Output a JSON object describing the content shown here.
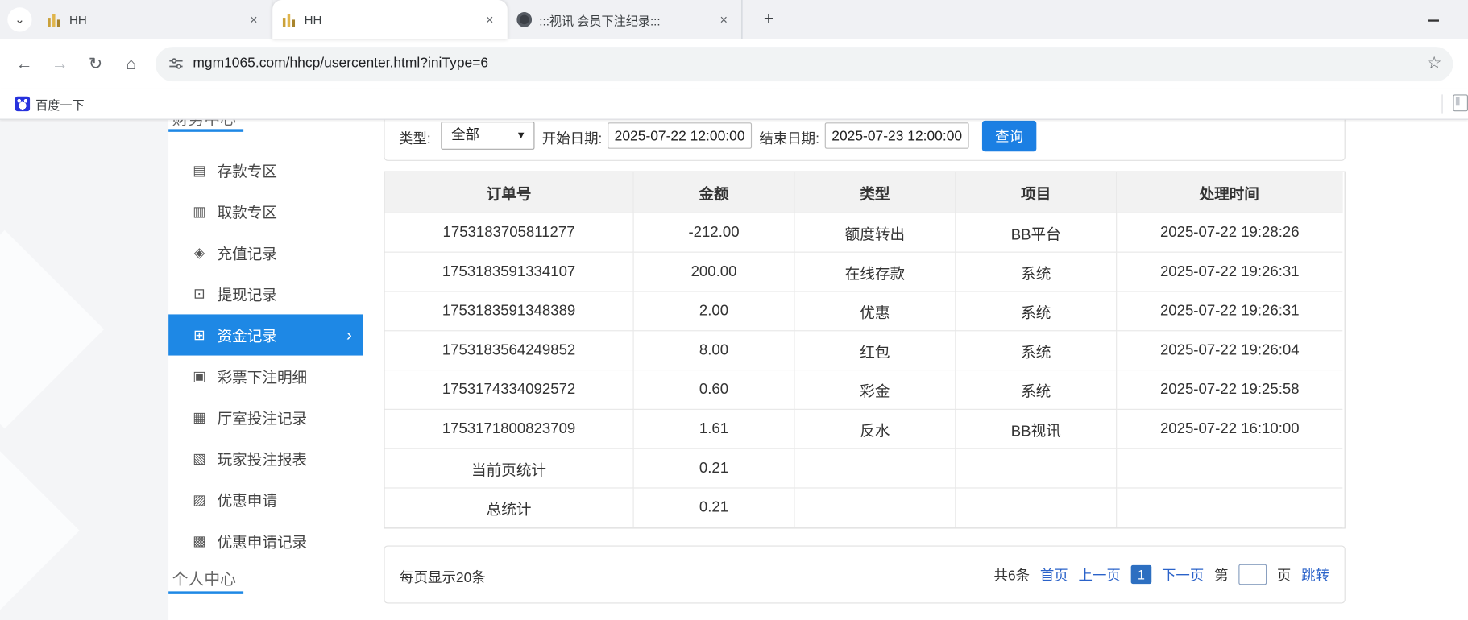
{
  "browser": {
    "tabs": [
      {
        "title": "HH",
        "favicon": "gold-chart-favicon",
        "active": false
      },
      {
        "title": "HH",
        "favicon": "gold-chart-favicon",
        "active": true
      },
      {
        "title": ":::视讯 会员下注纪录:::",
        "favicon": "dark-circle-favicon",
        "active": false
      }
    ],
    "url": "mgm1065.com/hhcp/usercenter.html?iniType=6",
    "bookmark_label": "百度一下"
  },
  "icons": {
    "tab_search_glyph": "⌄",
    "close_glyph": "×",
    "new_tab_glyph": "+",
    "back_glyph": "←",
    "forward_glyph": "→",
    "reload_glyph": "↻",
    "home_glyph": "⌂",
    "star_glyph": "☆",
    "chevron_right_glyph": "›",
    "select_arrow_glyph": "▼"
  },
  "sidebar": {
    "top_heading": "财务中心",
    "items": [
      {
        "label": "存款专区",
        "icon": "deposit-icon",
        "active": false
      },
      {
        "label": "取款专区",
        "icon": "withdraw-icon",
        "active": false
      },
      {
        "label": "充值记录",
        "icon": "recharge-record-icon",
        "active": false
      },
      {
        "label": "提现记录",
        "icon": "withdrawal-record-icon",
        "active": false
      },
      {
        "label": "资金记录",
        "icon": "funds-record-icon",
        "active": true
      },
      {
        "label": "彩票下注明细",
        "icon": "lottery-detail-icon",
        "active": false
      },
      {
        "label": "厅室投注记录",
        "icon": "hall-bet-record-icon",
        "active": false
      },
      {
        "label": "玩家投注报表",
        "icon": "player-report-icon",
        "active": false
      },
      {
        "label": "优惠申请",
        "icon": "promo-apply-icon",
        "active": false
      },
      {
        "label": "优惠申请记录",
        "icon": "promo-record-icon",
        "active": false
      }
    ],
    "bottom_heading": "个人中心"
  },
  "filters": {
    "type_label": "类型:",
    "type_value": "全部",
    "start_label": "开始日期:",
    "start_value": "2025-07-22 12:00:00",
    "end_label": "结束日期:",
    "end_value": "2025-07-23 12:00:00",
    "query_button": "查询"
  },
  "table": {
    "headers": [
      "订单号",
      "金额",
      "类型",
      "项目",
      "处理时间"
    ],
    "rows": [
      [
        "1753183705811277",
        "-212.00",
        "额度转出",
        "BB平台",
        "2025-07-22 19:28:26"
      ],
      [
        "1753183591334107",
        "200.00",
        "在线存款",
        "系统",
        "2025-07-22 19:26:31"
      ],
      [
        "1753183591348389",
        "2.00",
        "优惠",
        "系统",
        "2025-07-22 19:26:31"
      ],
      [
        "1753183564249852",
        "8.00",
        "红包",
        "系统",
        "2025-07-22 19:26:04"
      ],
      [
        "1753174334092572",
        "0.60",
        "彩金",
        "系统",
        "2025-07-22 19:25:58"
      ],
      [
        "1753171800823709",
        "1.61",
        "反水",
        "BB视讯",
        "2025-07-22 16:10:00"
      ],
      [
        "当前页统计",
        "0.21",
        "",
        "",
        ""
      ],
      [
        "总统计",
        "0.21",
        "",
        "",
        ""
      ]
    ]
  },
  "pagination": {
    "per_page_text": "每页显示20条",
    "total_text": "共6条",
    "first": "首页",
    "prev": "上一页",
    "current_page": "1",
    "next": "下一页",
    "jump_prefix": "第",
    "jump_suffix": "页",
    "jump_button": "跳转",
    "jump_input_value": ""
  },
  "colors": {
    "accent_blue": "#1e88e5",
    "button_blue": "#1b7fe3",
    "link_blue": "#2a62c9",
    "table_header_bg": "#f2f2f2"
  }
}
